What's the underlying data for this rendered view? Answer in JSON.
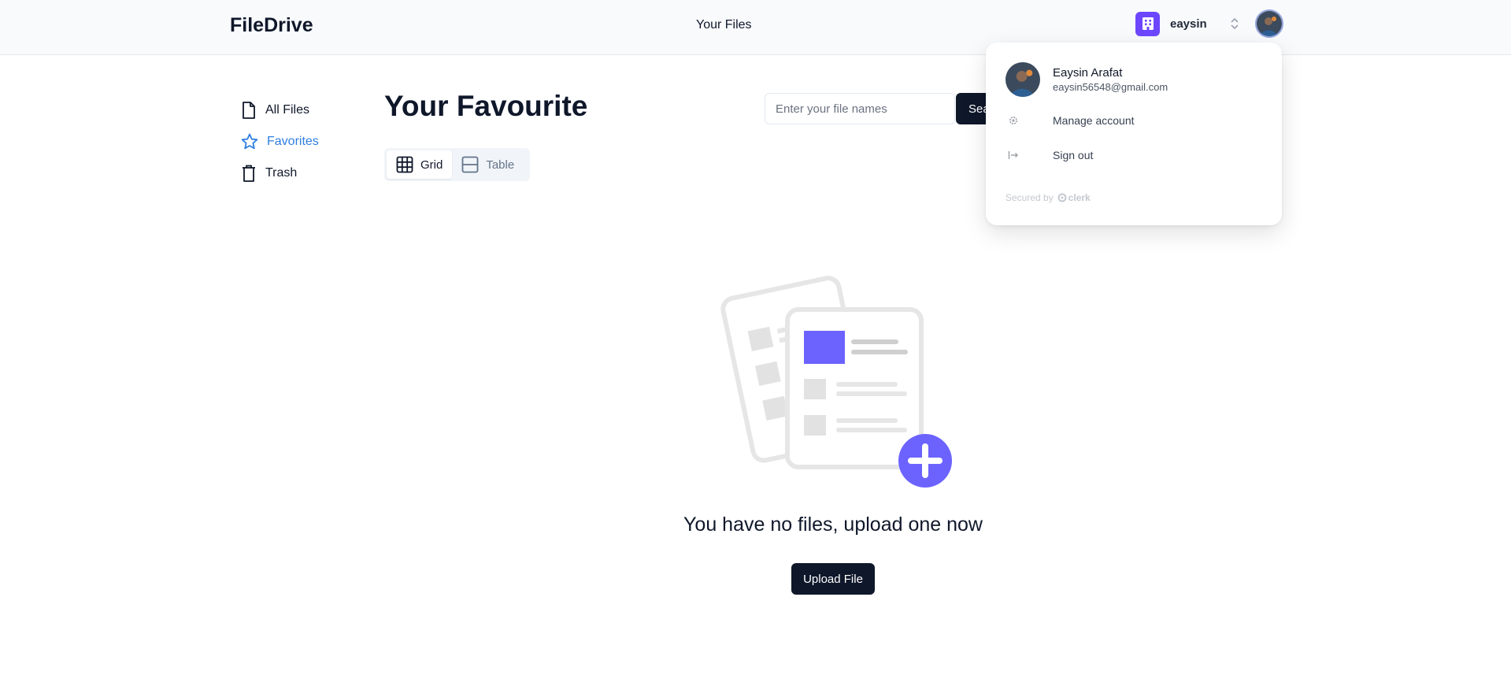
{
  "header": {
    "logo": "FileDrive",
    "nav_link": "Your Files",
    "org_name": "eaysin",
    "colors": {
      "org_accent": "#6c47ff",
      "header_bg": "#f8fafc"
    }
  },
  "sidebar": {
    "items": [
      {
        "label": "All Files",
        "icon": "file-icon",
        "active": false
      },
      {
        "label": "Favorites",
        "icon": "star-icon",
        "active": true
      },
      {
        "label": "Trash",
        "icon": "trash-icon",
        "active": false
      }
    ],
    "active_color": "#2f7fe0"
  },
  "main": {
    "title": "Your Favourite",
    "search": {
      "placeholder": "Enter your file names",
      "value": "",
      "button_label": "Sea"
    },
    "view_toggle": {
      "options": [
        {
          "label": "Grid",
          "icon": "grid-icon",
          "selected": true
        },
        {
          "label": "Table",
          "icon": "table-icon",
          "selected": false
        }
      ]
    },
    "empty_state": {
      "message": "You have no files, upload one now",
      "upload_label": "Upload File",
      "illustration_icon": "empty-files-illustration",
      "accent": "#6c63ff"
    }
  },
  "user_menu": {
    "name": "Eaysin Arafat",
    "email": "eaysin56548@gmail.com",
    "actions": [
      {
        "label": "Manage account",
        "icon": "gear-icon"
      },
      {
        "label": "Sign out",
        "icon": "sign-out-icon"
      }
    ],
    "footer_prefix": "Secured by",
    "footer_brand": "clerk"
  }
}
